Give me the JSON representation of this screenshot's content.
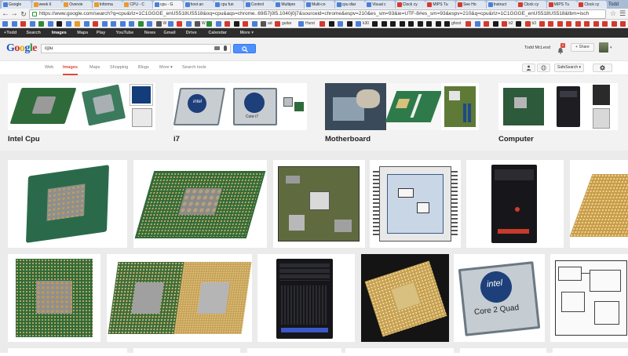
{
  "tabs": [
    {
      "label": "Google",
      "color": "#4a7fd8"
    },
    {
      "label": "week 6",
      "color": "#e89b2f"
    },
    {
      "label": "Overvie",
      "color": "#e89b2f"
    },
    {
      "label": "Informa",
      "color": "#e89b2f"
    },
    {
      "label": "CPU - C",
      "color": "#e89b2f"
    },
    {
      "label": "cpu - G",
      "color": "#4a7fd8",
      "active": true
    },
    {
      "label": "host an",
      "color": "#4a7fd8"
    },
    {
      "label": "cpu fun",
      "color": "#4a7fd8"
    },
    {
      "label": "Control",
      "color": "#4a7fd8"
    },
    {
      "label": "Multipro",
      "color": "#4a7fd8"
    },
    {
      "label": "Multi-co",
      "color": "#4a7fd8"
    },
    {
      "label": "cpu diar",
      "color": "#4a7fd8"
    },
    {
      "label": "Visual c",
      "color": "#4a7fd8"
    },
    {
      "label": "Clock cy",
      "color": "#d23a2e"
    },
    {
      "label": "MIPS Tu",
      "color": "#d23a2e"
    },
    {
      "label": "See Ho",
      "color": "#d23a2e"
    },
    {
      "label": "Instruct",
      "color": "#4a7fd8"
    },
    {
      "label": "Clock cy",
      "color": "#d23a2e"
    },
    {
      "label": "MIPS Tu",
      "color": "#d23a2e"
    },
    {
      "label": "Clock cy",
      "color": "#d23a2e"
    }
  ],
  "window_label": "Todd",
  "url": "https://www.google.com/search?q=cpu&rlz=1C1GGGE_enUS518US518&oq=cpu&aqs=chrome..69i57j0l5.1040j0j7&sourceid=chrome&espv=210&es_sm=93&ie=UTF-8#es_sm=93&espv=210&q=cpu&rlz=1C1GGGE_enUS518US518&tbm=isch",
  "bookmarks": [
    {
      "label": "",
      "color": "#4a7fd8"
    },
    {
      "label": "",
      "color": "#4a7fd8"
    },
    {
      "label": "",
      "color": "#d23a2e"
    },
    {
      "label": "",
      "color": "#4a7fd8"
    },
    {
      "label": "",
      "color": "#2e8b3a"
    },
    {
      "label": "",
      "color": "#4a7fd8"
    },
    {
      "label": "",
      "color": "#1b1b1b"
    },
    {
      "label": "",
      "color": "#4a7fd8"
    },
    {
      "label": "",
      "color": "#e89b2f"
    },
    {
      "label": "",
      "color": "#4a7fd8"
    },
    {
      "label": "",
      "color": "#d23a2e"
    },
    {
      "label": "",
      "color": "#4a7fd8"
    },
    {
      "label": "",
      "color": "#4a7fd8"
    },
    {
      "label": "",
      "color": "#4a7fd8"
    },
    {
      "label": "",
      "color": "#4a7fd8"
    },
    {
      "label": "",
      "color": "#2e8b3a"
    },
    {
      "label": "",
      "color": "#4a7fd8"
    },
    {
      "label": "W",
      "color": "#555555"
    },
    {
      "label": "",
      "color": "#4a7fd8"
    },
    {
      "label": "",
      "color": "#d23a2e"
    },
    {
      "label": "",
      "color": "#4a7fd8"
    },
    {
      "label": "W",
      "color": "#555555"
    },
    {
      "label": "",
      "color": "#2e8b3a"
    },
    {
      "label": "",
      "color": "#4a7fd8"
    },
    {
      "label": "",
      "color": "#d23a2e"
    },
    {
      "label": "",
      "color": "#1b1b1b"
    },
    {
      "label": "",
      "color": "#d23a2e"
    },
    {
      "label": "",
      "color": "#4a7fd8"
    },
    {
      "label": "ad",
      "color": "#555555"
    },
    {
      "label": "guitar",
      "color": "#d23a2e"
    },
    {
      "label": "Hurst",
      "color": "#4a7fd8"
    },
    {
      "label": "",
      "color": "#d23a2e"
    },
    {
      "label": "",
      "color": "#1b1b1b"
    },
    {
      "label": "",
      "color": "#4a7fd8"
    },
    {
      "label": "",
      "color": "#1b1b1b"
    },
    {
      "label": "k30",
      "color": "#4a7fd8"
    },
    {
      "label": "",
      "color": "#1b1b1b"
    },
    {
      "label": "",
      "color": "#1b1b1b"
    },
    {
      "label": "",
      "color": "#1b1b1b"
    },
    {
      "label": "",
      "color": "#1b1b1b"
    },
    {
      "label": "",
      "color": "#1b1b1b"
    },
    {
      "label": "",
      "color": "#1b1b1b"
    },
    {
      "label": "",
      "color": "#1b1b1b"
    },
    {
      "label": "",
      "color": "#1b1b1b"
    },
    {
      "label": "ghost",
      "color": "#1b1b1b"
    },
    {
      "label": "",
      "color": "#d23a2e"
    },
    {
      "label": "",
      "color": "#4a7fd8"
    },
    {
      "label": "",
      "color": "#d23a2e"
    },
    {
      "label": "",
      "color": "#1b1b1b"
    },
    {
      "label": "b2",
      "color": "#d23a2e"
    },
    {
      "label": "",
      "color": "#1b1b1b"
    },
    {
      "label": "b3",
      "color": "#d23a2e"
    },
    {
      "label": "",
      "color": "#d23a2e"
    },
    {
      "label": "",
      "color": "#d23a2e"
    },
    {
      "label": "",
      "color": "#d23a2e"
    },
    {
      "label": "",
      "color": "#d23a2e"
    },
    {
      "label": "",
      "color": "#d23a2e"
    },
    {
      "label": "",
      "color": "#d23a2e"
    },
    {
      "label": "",
      "color": "#d23a2e"
    },
    {
      "label": "",
      "color": "#d23a2e"
    },
    {
      "label": "",
      "color": "#d23a2e"
    },
    {
      "label": "",
      "color": "#d23a2e"
    },
    {
      "label": "",
      "color": "#d23a2e"
    },
    {
      "label": "",
      "color": "#d23a2e"
    }
  ],
  "gbar": [
    "+Todd",
    "Search",
    "Images",
    "Maps",
    "Play",
    "YouTube",
    "News",
    "Gmail",
    "Drive",
    "Calendar",
    "More ▾"
  ],
  "gbar_selected": "Images",
  "search": {
    "query": "cpu"
  },
  "user": {
    "name": "Todd McLeod",
    "notifications": "2",
    "share_label": "+ Share"
  },
  "filters": {
    "tabs": [
      "Web",
      "Images",
      "Maps",
      "Shopping",
      "Blogs",
      "More ▾",
      "Search tools"
    ],
    "selected": "Images",
    "safesearch": "SafeSearch ▾"
  },
  "related": [
    {
      "label": "Intel Cpu"
    },
    {
      "label": "i7"
    },
    {
      "label": "Motherboard"
    },
    {
      "label": "Computer"
    }
  ],
  "image_texts": {
    "intel": "intel",
    "inside": "inside",
    "core": "Core",
    "core_i7": "Core i7",
    "core2quad": "Core 2 Quad",
    "quad": "Quad"
  },
  "colors": {
    "gbar_bg": "#2d2d2d",
    "search_blue": "#4d90fe",
    "selected_red": "#dd4b39",
    "related_bg": "#f2f2f2",
    "grid_bg": "#ebebeb"
  }
}
